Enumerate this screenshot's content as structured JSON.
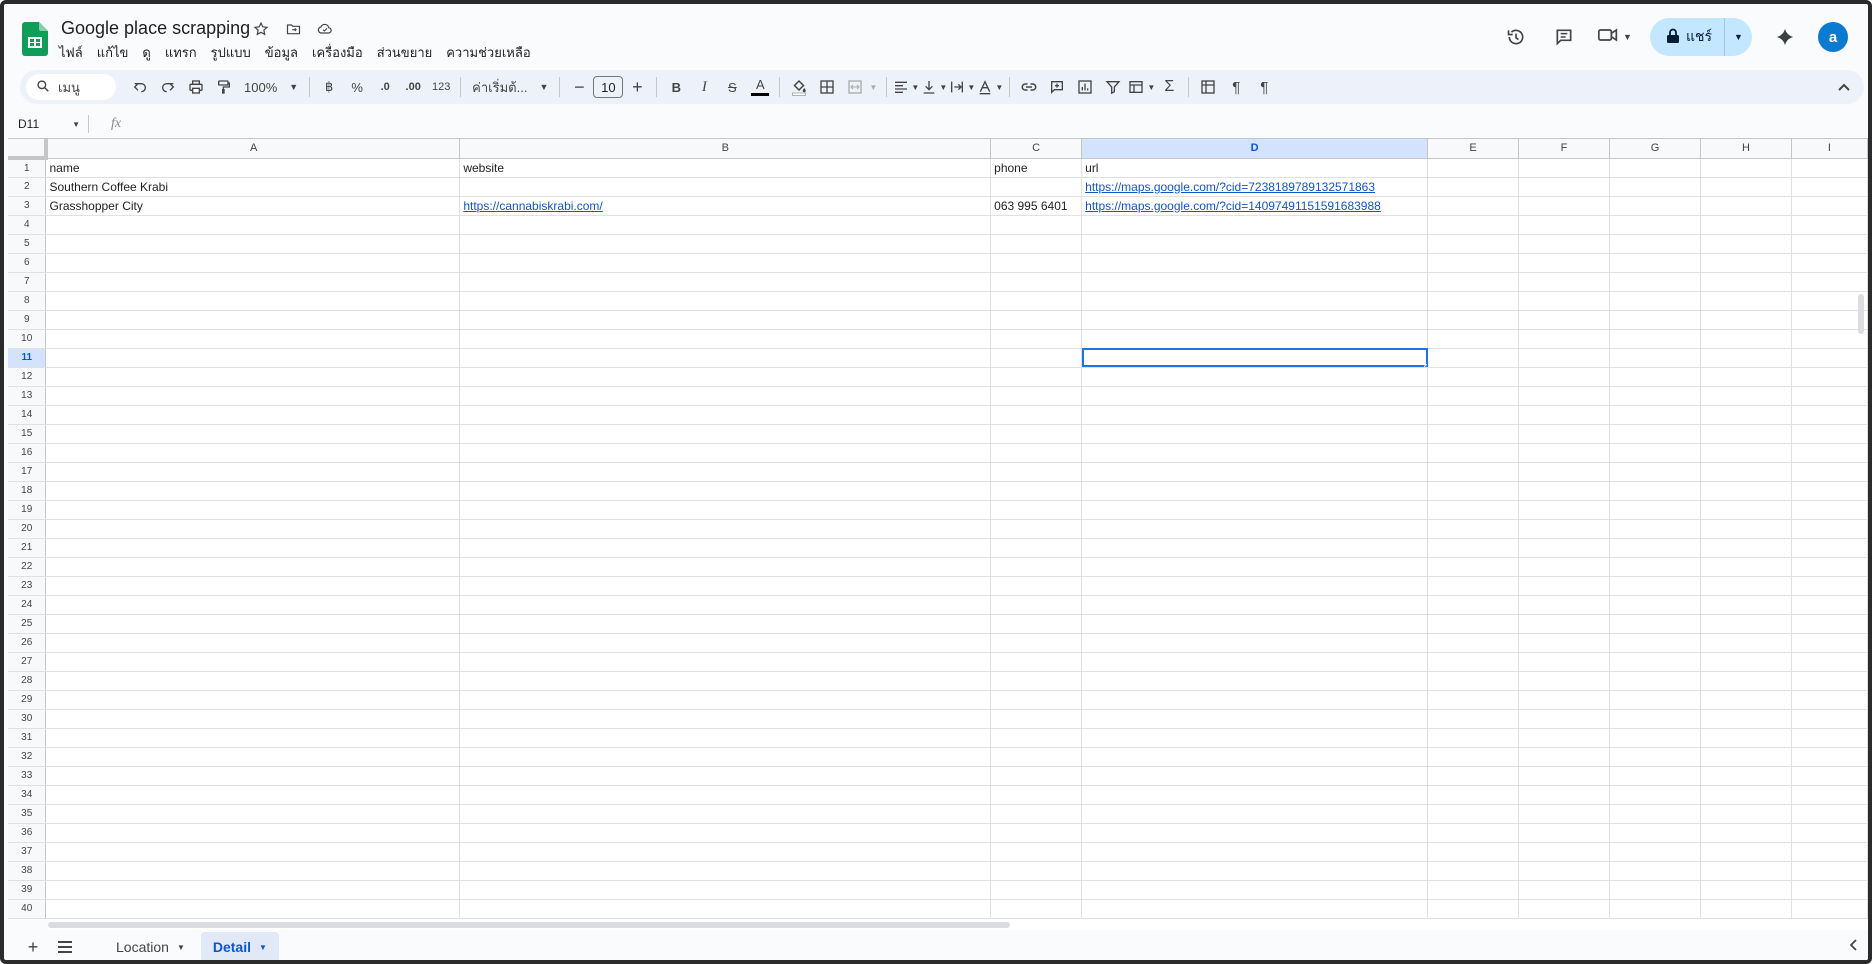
{
  "doc": {
    "title": "Google place scrapping"
  },
  "menu": [
    "ไฟล์",
    "แก้ไข",
    "ดู",
    "แทรก",
    "รูปแบบ",
    "ข้อมูล",
    "เครื่องมือ",
    "ส่วนขยาย",
    "ความช่วยเหลือ"
  ],
  "header": {
    "share_label": "แชร์",
    "avatar_letter": "a"
  },
  "toolbar": {
    "search_label": "เมนู",
    "zoom": "100%",
    "currency": "฿",
    "percent": "%",
    "dec_decrease": ".0",
    "dec_increase": ".00",
    "number_format": "123",
    "font": "ค่าเริ่มต้...",
    "font_size": "10"
  },
  "formula": {
    "cell_ref": "D11",
    "fx": "fx",
    "value": ""
  },
  "grid": {
    "columns": [
      "A",
      "B",
      "C",
      "D",
      "E",
      "F",
      "G",
      "H",
      "I"
    ],
    "selected_column": "D",
    "selected_row": 11,
    "row_count": 40,
    "rows": [
      {
        "A": "name",
        "B": "website",
        "C": "phone",
        "D": "url"
      },
      {
        "A": "Southern Coffee Krabi",
        "B": "",
        "C": "",
        "D": "https://maps.google.com/?cid=7238189789132571863"
      },
      {
        "A": "Grasshopper City",
        "B": "https://cannabiskrabi.com/",
        "C": "063 995 6401",
        "D": "https://maps.google.com/?cid=14097491151591683988"
      }
    ]
  },
  "sheets": {
    "tabs": [
      "Location",
      "Detail"
    ],
    "active": "Detail"
  },
  "colors": {
    "accent": "#0b57d0",
    "share_bg": "#c2e7ff",
    "link": "#1155cc",
    "sheets_green": "#0f9d58"
  }
}
